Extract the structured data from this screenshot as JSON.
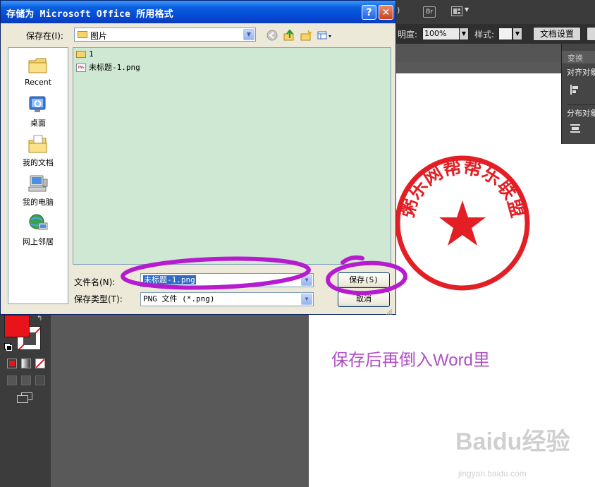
{
  "dialog": {
    "title": "存储为 Microsoft Office 所用格式",
    "help_glyph": "?",
    "close_glyph": "✕",
    "save_in_label": "保存在(I):",
    "save_in_value": "图片",
    "places": [
      {
        "label": "Recent",
        "icon": "recent-folder-icon"
      },
      {
        "label": "桌面",
        "icon": "desktop-icon"
      },
      {
        "label": "我的文档",
        "icon": "my-documents-icon"
      },
      {
        "label": "我的电脑",
        "icon": "my-computer-icon"
      },
      {
        "label": "网上邻居",
        "icon": "network-places-icon"
      }
    ],
    "files": [
      {
        "name": "1",
        "type": "folder"
      },
      {
        "name": "未标题-1.png",
        "type": "png"
      }
    ],
    "file_name_label": "文件名(N):",
    "file_name_value": "未标题-1.png",
    "file_type_label": "保存类型(T):",
    "file_type_value": "PNG 文件 (*.png)",
    "save_button": "保存(S)",
    "cancel_button": "取消"
  },
  "illustrator": {
    "opacity_label": "明度:",
    "opacity_value": "100%",
    "style_label": "样式:",
    "doc_settings_button": "文档设置",
    "br_label": "Br",
    "panel": {
      "tab_transform": "变换",
      "align_objects": "对齐对象",
      "distribute_objects": "分布对象"
    },
    "fill_color": "#e8141a"
  },
  "stamp": {
    "text": "粥乐网帮帮乐联盟",
    "color": "#e31e24"
  },
  "caption": "保存后再倒入Word里",
  "watermark": {
    "main": "Baidu经验",
    "sub": "jingyan.baidu.com"
  },
  "highlight_color": "#b61bd0"
}
